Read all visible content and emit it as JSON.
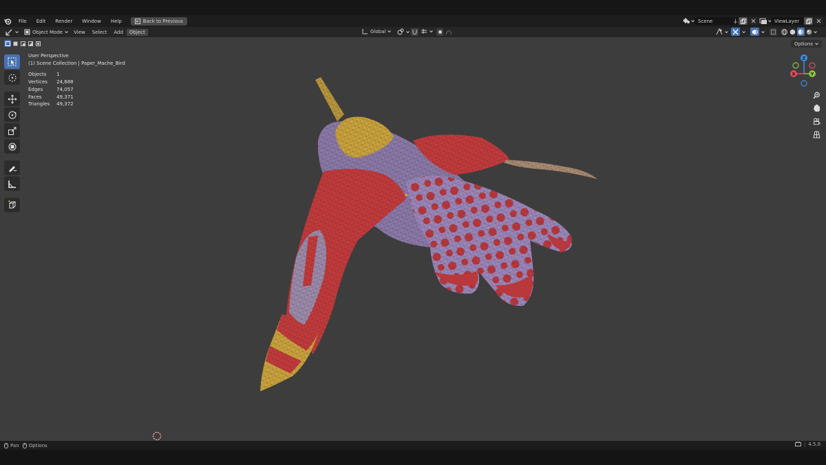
{
  "menu": {
    "items": [
      "File",
      "Edit",
      "Render",
      "Window",
      "Help"
    ],
    "back_button": "Back to Previous",
    "scene_name": "Scene",
    "view_layer": "ViewLayer"
  },
  "header": {
    "mode": "Object Mode",
    "view": "View",
    "select": "Select",
    "add": "Add",
    "object": "Object",
    "transform_orientation": "Global"
  },
  "viewport": {
    "options_label": "Options",
    "perspective": "User Perspective",
    "collection_path": "(1) Scene Collection | Paper_Mache_Bird",
    "stats": [
      {
        "label": "Objects",
        "value": "1"
      },
      {
        "label": "Vertices",
        "value": "24,688"
      },
      {
        "label": "Edges",
        "value": "74,057"
      },
      {
        "label": "Faces",
        "value": "49,371"
      },
      {
        "label": "Triangles",
        "value": "49,372"
      }
    ],
    "gizmo_axes": {
      "x": "X",
      "y": "Y",
      "z": "Z"
    },
    "axis_colors": {
      "x": "#e84a5f",
      "y": "#8bc53f",
      "z": "#3d8ee0"
    }
  },
  "status": {
    "pan": "Pan",
    "options": "Options",
    "version": "4.5.0"
  },
  "icons": {
    "tools": [
      "select-box-icon",
      "cursor-icon",
      "move-icon",
      "rotate-icon",
      "scale-icon",
      "transform-icon",
      "annotate-icon",
      "measure-icon",
      "add-cube-icon"
    ],
    "nav": [
      "zoom-icon",
      "hand-pan-icon",
      "camera-icon",
      "grid-icon"
    ]
  },
  "colors": {
    "accent": "#4772b3",
    "viewport_bg": "#3d3d3d",
    "mesh_red": "#c23a3a",
    "mesh_lavender": "#9a86b8",
    "mesh_yellow": "#c9a23a"
  }
}
